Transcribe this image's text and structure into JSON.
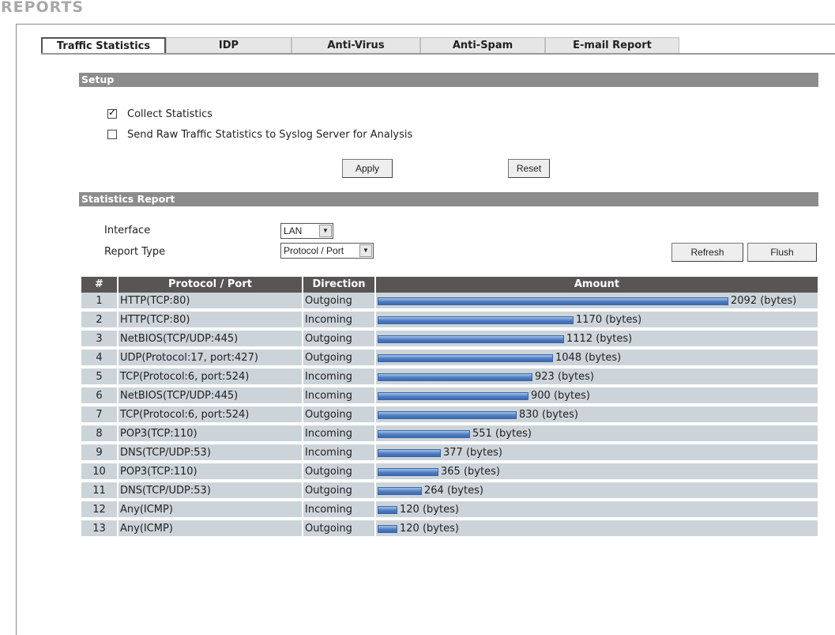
{
  "page": {
    "title": "REPORTS"
  },
  "tabs": [
    {
      "label": "Traffic Statistics",
      "active": true
    },
    {
      "label": "IDP",
      "active": false
    },
    {
      "label": "Anti-Virus",
      "active": false
    },
    {
      "label": "Anti-Spam",
      "active": false
    },
    {
      "label": "E-mail Report",
      "active": false
    }
  ],
  "setup": {
    "section_title": "Setup",
    "collect_statistics": {
      "label": "Collect Statistics",
      "checked": true
    },
    "send_raw": {
      "label": "Send Raw Traffic Statistics to Syslog Server for Analysis",
      "checked": false
    },
    "apply_label": "Apply",
    "reset_label": "Reset"
  },
  "report": {
    "section_title": "Statistics Report",
    "interface_label": "Interface",
    "interface_value": "LAN",
    "report_type_label": "Report Type",
    "report_type_value": "Protocol / Port",
    "refresh_label": "Refresh",
    "flush_label": "Flush"
  },
  "table": {
    "columns": [
      "#",
      "Protocol / Port",
      "Direction",
      "Amount"
    ],
    "unit": "(bytes)",
    "max_amount": 2092,
    "rows": [
      {
        "num": "1",
        "protocol": "HTTP(TCP:80)",
        "direction": "Outgoing",
        "amount": 2092
      },
      {
        "num": "2",
        "protocol": "HTTP(TCP:80)",
        "direction": "Incoming",
        "amount": 1170
      },
      {
        "num": "3",
        "protocol": "NetBIOS(TCP/UDP:445)",
        "direction": "Outgoing",
        "amount": 1112
      },
      {
        "num": "4",
        "protocol": "UDP(Protocol:17, port:427)",
        "direction": "Outgoing",
        "amount": 1048
      },
      {
        "num": "5",
        "protocol": "TCP(Protocol:6, port:524)",
        "direction": "Incoming",
        "amount": 923
      },
      {
        "num": "6",
        "protocol": "NetBIOS(TCP/UDP:445)",
        "direction": "Incoming",
        "amount": 900
      },
      {
        "num": "7",
        "protocol": "TCP(Protocol:6, port:524)",
        "direction": "Outgoing",
        "amount": 830
      },
      {
        "num": "8",
        "protocol": "POP3(TCP:110)",
        "direction": "Incoming",
        "amount": 551
      },
      {
        "num": "9",
        "protocol": "DNS(TCP/UDP:53)",
        "direction": "Incoming",
        "amount": 377
      },
      {
        "num": "10",
        "protocol": "POP3(TCP:110)",
        "direction": "Outgoing",
        "amount": 365
      },
      {
        "num": "11",
        "protocol": "DNS(TCP/UDP:53)",
        "direction": "Outgoing",
        "amount": 264
      },
      {
        "num": "12",
        "protocol": "Any(ICMP)",
        "direction": "Incoming",
        "amount": 120
      },
      {
        "num": "13",
        "protocol": "Any(ICMP)",
        "direction": "Outgoing",
        "amount": 120
      }
    ]
  }
}
